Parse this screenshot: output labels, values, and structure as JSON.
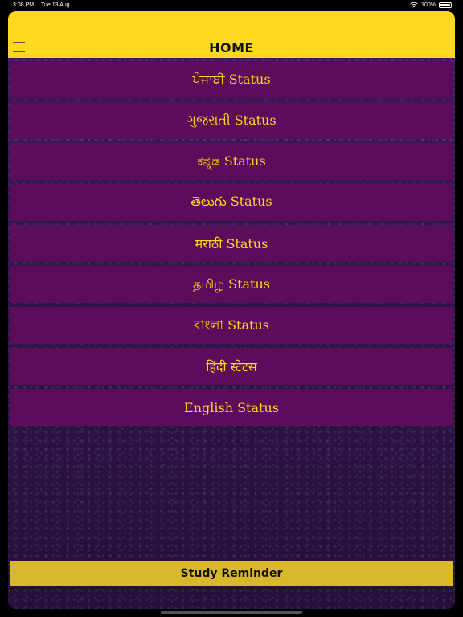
{
  "status_bar": {
    "time": "3:08 PM",
    "date": "Tue 13 Aug",
    "battery": "100%"
  },
  "navbar": {
    "title": "HOME",
    "menu_icon": "hamburger-menu-icon"
  },
  "status_items": [
    {
      "label": "ਪੰਜਾਬੀ Status"
    },
    {
      "label": "ગુજરાતી Status"
    },
    {
      "label": "ಕನ್ನಡ Status"
    },
    {
      "label": "తెలుగు Status"
    },
    {
      "label": "मराठी Status"
    },
    {
      "label": "தமிழ் Status"
    },
    {
      "label": "বাংলা Status"
    },
    {
      "label": "हिंदी स्टेटस"
    },
    {
      "label": "English Status"
    }
  ],
  "footer": {
    "reminder_label": "Study Reminder"
  },
  "colors": {
    "accent": "#fcd91f",
    "item_bg": "#5b0c5a",
    "button_bg": "#d9b92b"
  }
}
